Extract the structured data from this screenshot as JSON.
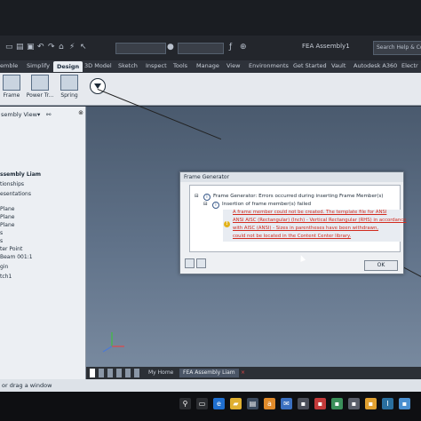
{
  "app": {
    "document_title": "FEA Assembly1",
    "search_placeholder": "Search Help & Co"
  },
  "ribbon_tabs": [
    {
      "label": "emble",
      "active": false
    },
    {
      "label": "Simplify",
      "active": false
    },
    {
      "label": "Design",
      "active": true
    },
    {
      "label": "3D Model",
      "active": false
    },
    {
      "label": "Sketch",
      "active": false
    },
    {
      "label": "Inspect",
      "active": false
    },
    {
      "label": "Tools",
      "active": false
    },
    {
      "label": "Manage",
      "active": false
    },
    {
      "label": "View",
      "active": false
    },
    {
      "label": "Environments",
      "active": false
    },
    {
      "label": "Get Started",
      "active": false
    },
    {
      "label": "Vault",
      "active": false
    },
    {
      "label": "Autodesk A360",
      "active": false
    },
    {
      "label": "Electr",
      "active": false
    }
  ],
  "ribbon_buttons": {
    "frame": "Frame",
    "power_transmission": "Power Tr...",
    "spring": "Spring"
  },
  "browser": {
    "view_label": "sembly View",
    "items": [
      {
        "label": "ssembly Liam",
        "bold": true
      },
      {
        "label": "tionships",
        "bold": false
      },
      {
        "label": "esentations",
        "bold": false
      },
      {
        "label": "Plane",
        "bold": false
      },
      {
        "label": "Plane",
        "bold": false
      },
      {
        "label": "Plane",
        "bold": false
      },
      {
        "label": "s",
        "bold": false
      },
      {
        "label": "s",
        "bold": false
      },
      {
        "label": "ter Point",
        "bold": false
      },
      {
        "label": "Beam 001:1",
        "bold": false
      },
      {
        "label": "gin",
        "bold": false
      },
      {
        "label": "tch1",
        "bold": false
      }
    ]
  },
  "dialog": {
    "title": "Frame Generator",
    "line1": "Frame Generator: Errors occurred during inserting Frame Member(s)",
    "line2": "Insertion of frame member(s) failed",
    "error_lines": [
      "A frame member could not be created.  The template file for ANSI",
      "ANSI AISC (Rectangular) (Inch) - Vertical Rectangular (RHS) in accordance",
      "with AISC (ANSI) - Sizes in parentheses have been withdrawn,",
      "could not be located in the Content Center library."
    ],
    "ok_label": "OK"
  },
  "document_tabs": {
    "my_home": "My Home",
    "active_doc": "FEA Assembly Liam"
  },
  "status_text": "or drag a window",
  "colors": {
    "error_text": "#d12a1e",
    "ribbon_bg": "#e6e9ee",
    "viewport_top": "#4a5a6e",
    "viewport_bottom": "#7f90a5"
  },
  "taskbar_icons": [
    "search-icon",
    "task-view-icon",
    "edge-icon",
    "file-explorer-icon",
    "store-icon",
    "amazon-icon",
    "mail-icon",
    "app-icon",
    "app-icon",
    "app-icon",
    "app-icon",
    "app-icon",
    "app-icon",
    "app-icon",
    "inventor-icon",
    "app-icon",
    "app-icon"
  ]
}
